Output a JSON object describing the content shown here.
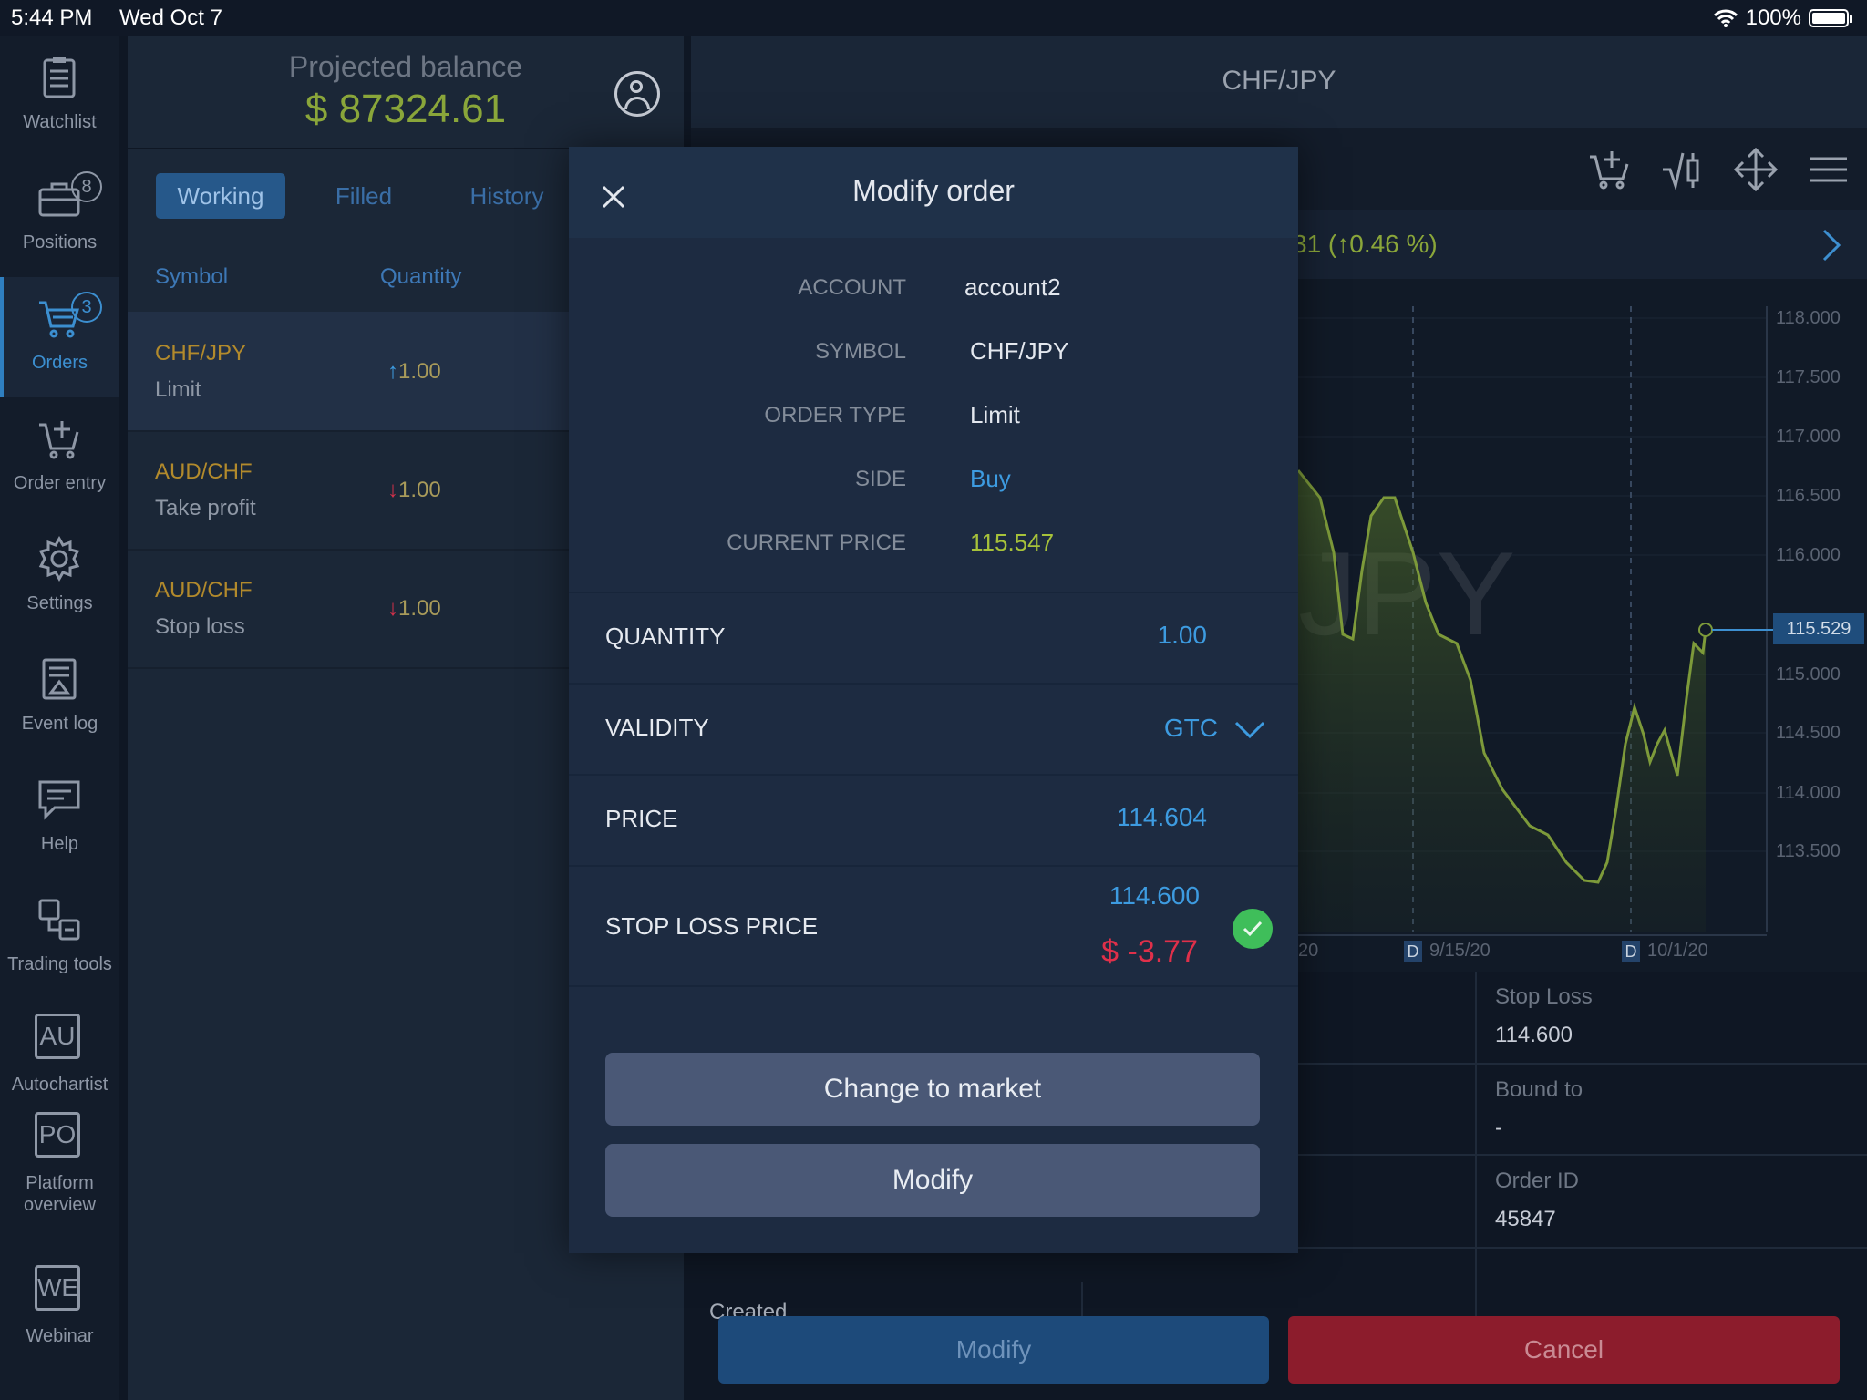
{
  "status_bar": {
    "time": "5:44 PM",
    "date": "Wed Oct 7",
    "battery": "100%"
  },
  "nav": {
    "watchlist": "Watchlist",
    "positions": "Positions",
    "positions_badge": "8",
    "orders": "Orders",
    "orders_badge": "3",
    "order_entry": "Order entry",
    "settings": "Settings",
    "event_log": "Event log",
    "help": "Help",
    "trading_tools": "Trading tools",
    "autochartist": "Autochartist",
    "autochartist_abbr": "AU",
    "platform_overview_1": "Platform",
    "platform_overview_2": "overview",
    "platform_overview_abbr": "PO",
    "webinar": "Webinar",
    "webinar_abbr": "WE"
  },
  "balance": {
    "label": "Projected balance",
    "value": "$ 87324.61"
  },
  "tabs": {
    "working": "Working",
    "filled": "Filled",
    "history": "History"
  },
  "columns": {
    "symbol": "Symbol",
    "quantity": "Quantity"
  },
  "orders": [
    {
      "symbol": "CHF/JPY",
      "type": "Limit",
      "arrow": "↑",
      "qty": "1.00",
      "dir": "up"
    },
    {
      "symbol": "AUD/CHF",
      "type": "Take profit",
      "arrow": "↓",
      "qty": "1.00",
      "dir": "down"
    },
    {
      "symbol": "AUD/CHF",
      "type": "Stop loss",
      "arrow": "↓",
      "qty": "1.00",
      "dir": "down"
    }
  ],
  "chart_panel": {
    "pair": "CHF/JPY",
    "change": "31 (↑0.46 %)",
    "watermark": "JPY",
    "last_price": "115.529",
    "price_labels": [
      "118.000",
      "117.500",
      "117.000",
      "116.500",
      "116.000",
      "115.000",
      "114.500",
      "114.000",
      "113.500"
    ],
    "date_labels": [
      "20",
      "9/15/20",
      "10/1/20"
    ],
    "d_marker": "D"
  },
  "details": {
    "stop_loss_label": "Stop Loss",
    "stop_loss_value": "114.600",
    "bound_to_label": "Bound to",
    "bound_to_value": "-",
    "order_id_label": "Order ID",
    "order_id_value": "45847",
    "created_label": "Created"
  },
  "bottom_buttons": {
    "modify": "Modify",
    "cancel": "Cancel"
  },
  "modal": {
    "title": "Modify order",
    "account_label": "ACCOUNT",
    "account_value": "account2",
    "symbol_label": "SYMBOL",
    "symbol_value": "CHF/JPY",
    "order_type_label": "ORDER TYPE",
    "order_type_value": "Limit",
    "side_label": "SIDE",
    "side_value": "Buy",
    "current_price_label": "CURRENT PRICE",
    "current_price_value": "115.547",
    "quantity_label": "QUANTITY",
    "quantity_value": "1.00",
    "validity_label": "VALIDITY",
    "validity_value": "GTC",
    "price_label": "PRICE",
    "price_value": "114.604",
    "stop_loss_label": "STOP LOSS PRICE",
    "stop_loss_value": "114.600",
    "stop_loss_pnl": "$ -3.77",
    "change_to_market": "Change to market",
    "modify": "Modify"
  },
  "colors": {
    "accent_blue": "#3d9be0",
    "gain_green": "#8aa63a",
    "loss_red": "#e0304a",
    "cancel_red": "#8c1c2c",
    "check_green": "#3fbe5a"
  }
}
